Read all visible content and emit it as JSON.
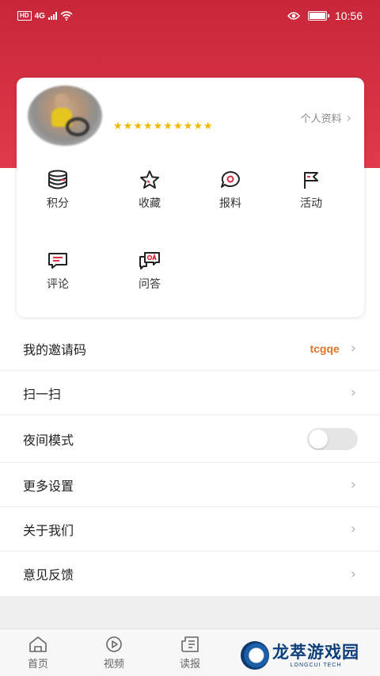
{
  "status_bar": {
    "network_badge": "HD",
    "network_type": "4G",
    "time": "10:56",
    "battery_level": 1.0
  },
  "profile": {
    "rating_stars": 10,
    "profile_link_label": "个人资料"
  },
  "shortcuts": [
    {
      "label": "积分",
      "icon": "coins-stack-icon"
    },
    {
      "label": "收藏",
      "icon": "star-icon"
    },
    {
      "label": "报料",
      "icon": "report-bubble-icon"
    },
    {
      "label": "活动",
      "icon": "flag-icon"
    },
    {
      "label": "评论",
      "icon": "comment-icon"
    },
    {
      "label": "问答",
      "icon": "qa-icon"
    }
  ],
  "menu": {
    "invite_label": "我的邀请码",
    "invite_code": "tcgqe",
    "scan_label": "扫一扫",
    "night_mode_label": "夜间模式",
    "night_mode_on": false,
    "more_settings_label": "更多设置",
    "about_label": "关于我们",
    "feedback_label": "意见反馈"
  },
  "tabbar": {
    "home": "首页",
    "video": "视频",
    "read": "读报"
  },
  "watermark": {
    "cn": "龙萃游戏园",
    "en": "LONGCUI TECH"
  },
  "colors": {
    "header_red": "#c8263a",
    "accent_orange": "#e0762a",
    "star_yellow": "#f2b800"
  }
}
